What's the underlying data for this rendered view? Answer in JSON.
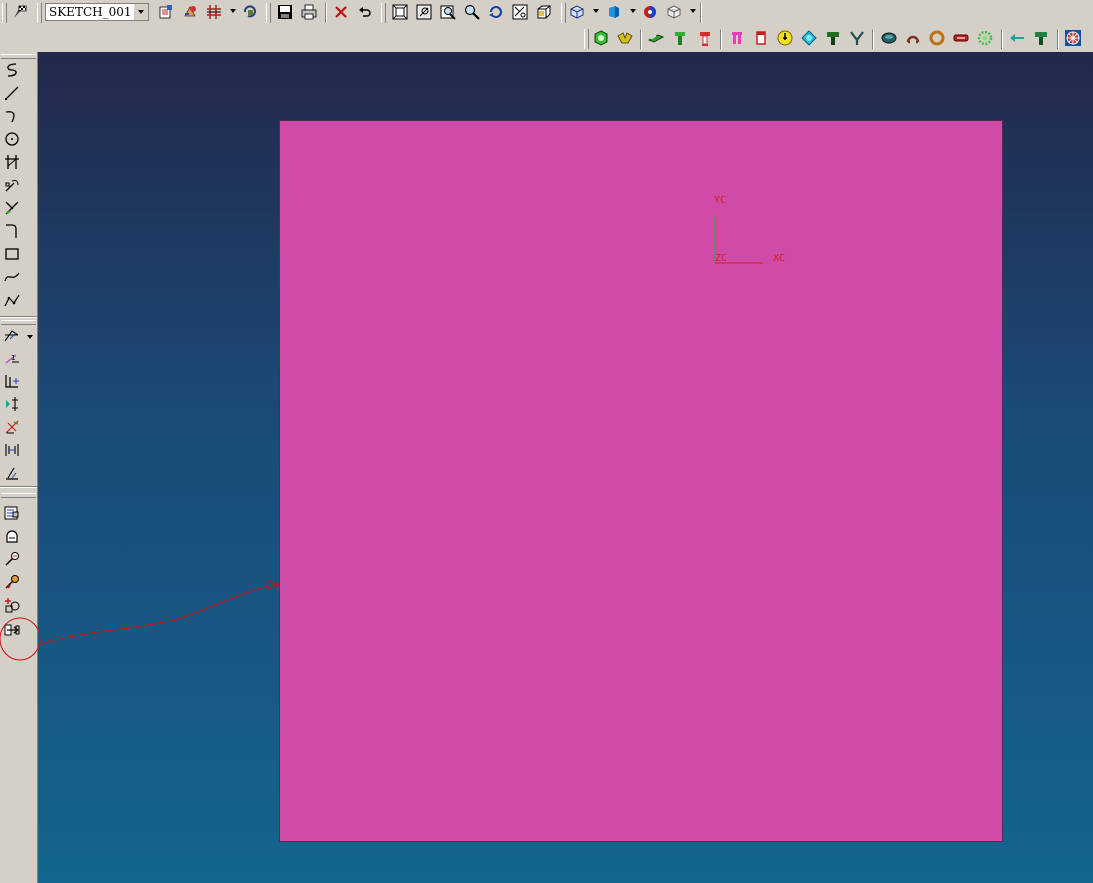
{
  "toolbar_top": {
    "sketch_name": "SKETCH_001",
    "icons": [
      "sketch-finish-icon",
      "sketch-select-dropdown",
      "orient-view-icon",
      "reattach-icon",
      "constraint-grid-icon",
      "update-model-icon",
      "save-icon",
      "print-icon",
      "delete-icon",
      "undo-icon",
      "fit-icon",
      "zoom-region-icon",
      "zoom-icon",
      "zoom-in-icon",
      "rotate-icon",
      "perspective-icon",
      "view-cube-icon",
      "wireframe-icon",
      "shaded-icon",
      "display-icon",
      "render-icon"
    ]
  },
  "toolbar_second": {
    "icons": [
      "feature-green-icon",
      "feature-yellow-icon",
      "extrude-icon",
      "boss-icon",
      "pocket-icon",
      "pad-icon",
      "hole-icon",
      "tool-icon",
      "circle-feature-icon",
      "slot-icon",
      "groove-icon",
      "chamfer-icon",
      "blend-icon",
      "ring-icon",
      "red-bar-icon",
      "gear-icon",
      "arrow-tool-icon",
      "tree-icon",
      "settings-wheel-icon"
    ]
  },
  "left_toolbar": {
    "curve_tools": [
      "profile-icon",
      "line-icon",
      "arc-icon",
      "circle-icon",
      "quick-trim-icon",
      "quick-extend-icon",
      "fillet-icon",
      "corner-icon",
      "rectangle-icon",
      "spline-icon",
      "polyline-icon"
    ],
    "constraint_tools": [
      "dimension-icon",
      "perpendicular-dim-icon",
      "horizontal-dim-icon",
      "vertical-dim-icon",
      "angular-dim-icon",
      "diameter-dim-icon",
      "parallel-dim-icon"
    ],
    "edit_tools": [
      "offset-curve-icon",
      "project-curve-icon",
      "edit-curve-icon",
      "edit-parameter-icon",
      "add-existing-icon",
      "convert-reference-icon"
    ]
  },
  "canvas": {
    "csys": {
      "x_label": "XC",
      "y_label": "YC",
      "z_label": "ZC"
    },
    "colors": {
      "sheet": "#d04aa8",
      "bg_top": "#23284b",
      "bg_bottom": "#13668f",
      "axis_x": "#d02020",
      "axis_y": "#40a040",
      "annotation": "#d01010"
    }
  }
}
